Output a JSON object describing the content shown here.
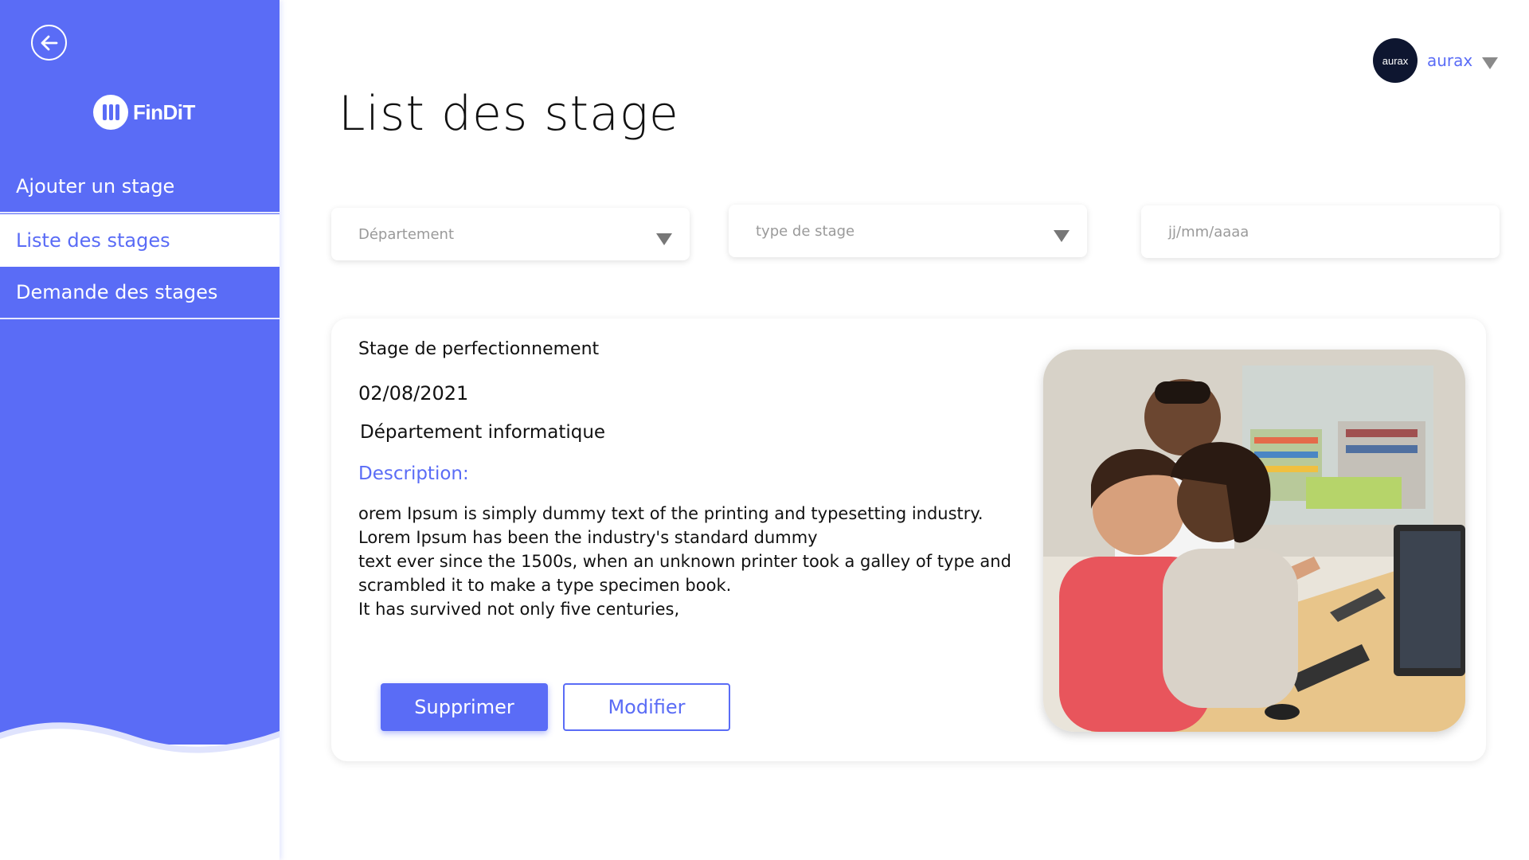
{
  "sidebar": {
    "logo_text": "FinDiT",
    "items": [
      {
        "label": "Ajouter un stage"
      },
      {
        "label": "Liste des stages"
      },
      {
        "label": "Demande des stages"
      }
    ],
    "active_index": 1
  },
  "header": {
    "avatar_text": "aurax",
    "user_name": "aurax"
  },
  "page": {
    "title": "List des stage"
  },
  "filters": {
    "department": {
      "placeholder": "Département"
    },
    "type": {
      "placeholder": "type de stage"
    },
    "date": {
      "placeholder": "jj/mm/aaaa"
    }
  },
  "card": {
    "title": "Stage de perfectionnement",
    "date": "02/08/2021",
    "department": "Département informatique",
    "description_label": "Description:",
    "description": "orem Ipsum is simply dummy text of the printing and typesetting industry.\nLorem Ipsum has been the industry's standard dummy\ntext ever since the 1500s, when an unknown printer took a galley of type and\n scrambled it to make a type specimen book.\nIt has survived not only five centuries,",
    "delete_label": "Supprimer",
    "edit_label": "Modifier",
    "image_icon": "people-at-computer-photo"
  },
  "colors": {
    "accent": "#5a6cf6",
    "avatar_bg": "#0e1630"
  }
}
